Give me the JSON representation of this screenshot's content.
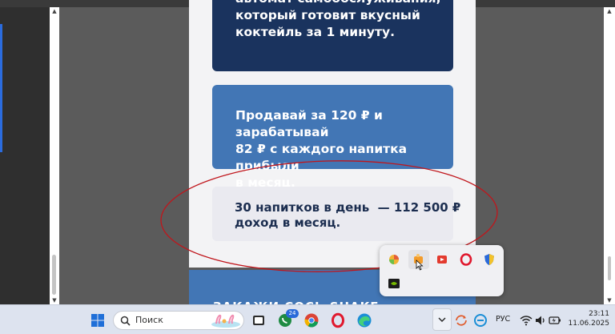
{
  "document": {
    "card_dark_lines": [
      "автомат самообслуживания,",
      "который готовит вкусный",
      "коктейль за 1 минуту."
    ],
    "card_mid_lines": [
      "Продавай за 120 ₽ и зарабатывай",
      "82 ₽ с каждого напитка прибыли",
      "в месяц."
    ],
    "card_light_lines": [
      "30 напитков в день  — 112 500 ₽",
      "доход в месяц."
    ],
    "next_card_text": "ЗАКАЖИ СОСЬ SHAKE"
  },
  "taskbar": {
    "search_placeholder": "Поиск",
    "whatsapp_badge": "24",
    "language": "РУС",
    "time": "23:11",
    "date": "11.06.2025"
  },
  "icons": {
    "start": "windows-start-icon",
    "search": "search-icon",
    "tray_items": [
      "colorful-ball-icon",
      "paint-app-icon",
      "red-video-icon",
      "opera-tray-icon",
      "shield-icon",
      "nvidia-icon"
    ]
  },
  "colors": {
    "card_dark": "#1a335e",
    "card_mid": "#4276b5",
    "card_light": "#eaeaf0",
    "annotation_red": "#c0151b",
    "taskbar": "#dde3ef"
  }
}
